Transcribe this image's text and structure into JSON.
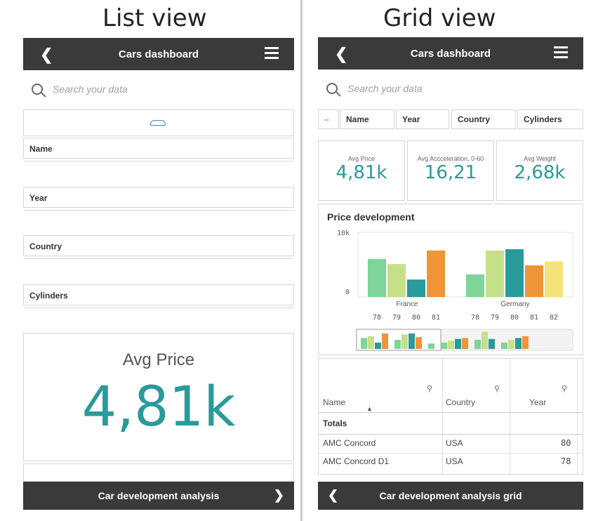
{
  "list": {
    "heading": "List view",
    "title": "Cars dashboard",
    "search_placeholder": "Search your data",
    "fields": [
      "Name",
      "Year",
      "Country",
      "Cylinders"
    ],
    "kpi_label": "Avg Price",
    "kpi_value": "4,81k",
    "bottom": "Car development analysis"
  },
  "grid": {
    "heading": "Grid view",
    "title": "Cars dashboard",
    "search_placeholder": "Search your data",
    "tabs": [
      "Name",
      "Year",
      "Country",
      "Cylinders"
    ],
    "kpis": [
      {
        "label": "Avg Price",
        "value": "4,81k"
      },
      {
        "label": "Avg Accceleration, 0-60",
        "value": "16,21"
      },
      {
        "label": "Avg Weight",
        "value": "2,68k"
      }
    ],
    "chart_title": "Price development",
    "table": {
      "headers": [
        "Name",
        "Country",
        "Year"
      ],
      "totals": "Totals",
      "rows": [
        {
          "name": "AMC Concord",
          "country": "USA",
          "year": "80"
        },
        {
          "name": "AMC Concord D1",
          "country": "USA",
          "year": "78"
        }
      ]
    },
    "bottom": "Car development analysis grid"
  },
  "chart_data": {
    "type": "bar",
    "title": "Price development",
    "ylim": [
      0,
      10000
    ],
    "yticks": [
      "10k",
      "0"
    ],
    "groups": [
      {
        "name": "France",
        "categories": [
          "78",
          "79",
          "80",
          "81"
        ],
        "values": [
          5900,
          5100,
          2700,
          7200
        ],
        "colors": [
          "#7fd49a",
          "#c6e08a",
          "#2a9a9a",
          "#ef9538"
        ]
      },
      {
        "name": "Germany",
        "categories": [
          "78",
          "79",
          "80",
          "81",
          "82"
        ],
        "values": [
          3500,
          7200,
          7400,
          4900,
          5500
        ],
        "colors": [
          "#7fd49a",
          "#c6e08a",
          "#2a9a9a",
          "#ef9538",
          "#f6e27a"
        ]
      }
    ]
  }
}
